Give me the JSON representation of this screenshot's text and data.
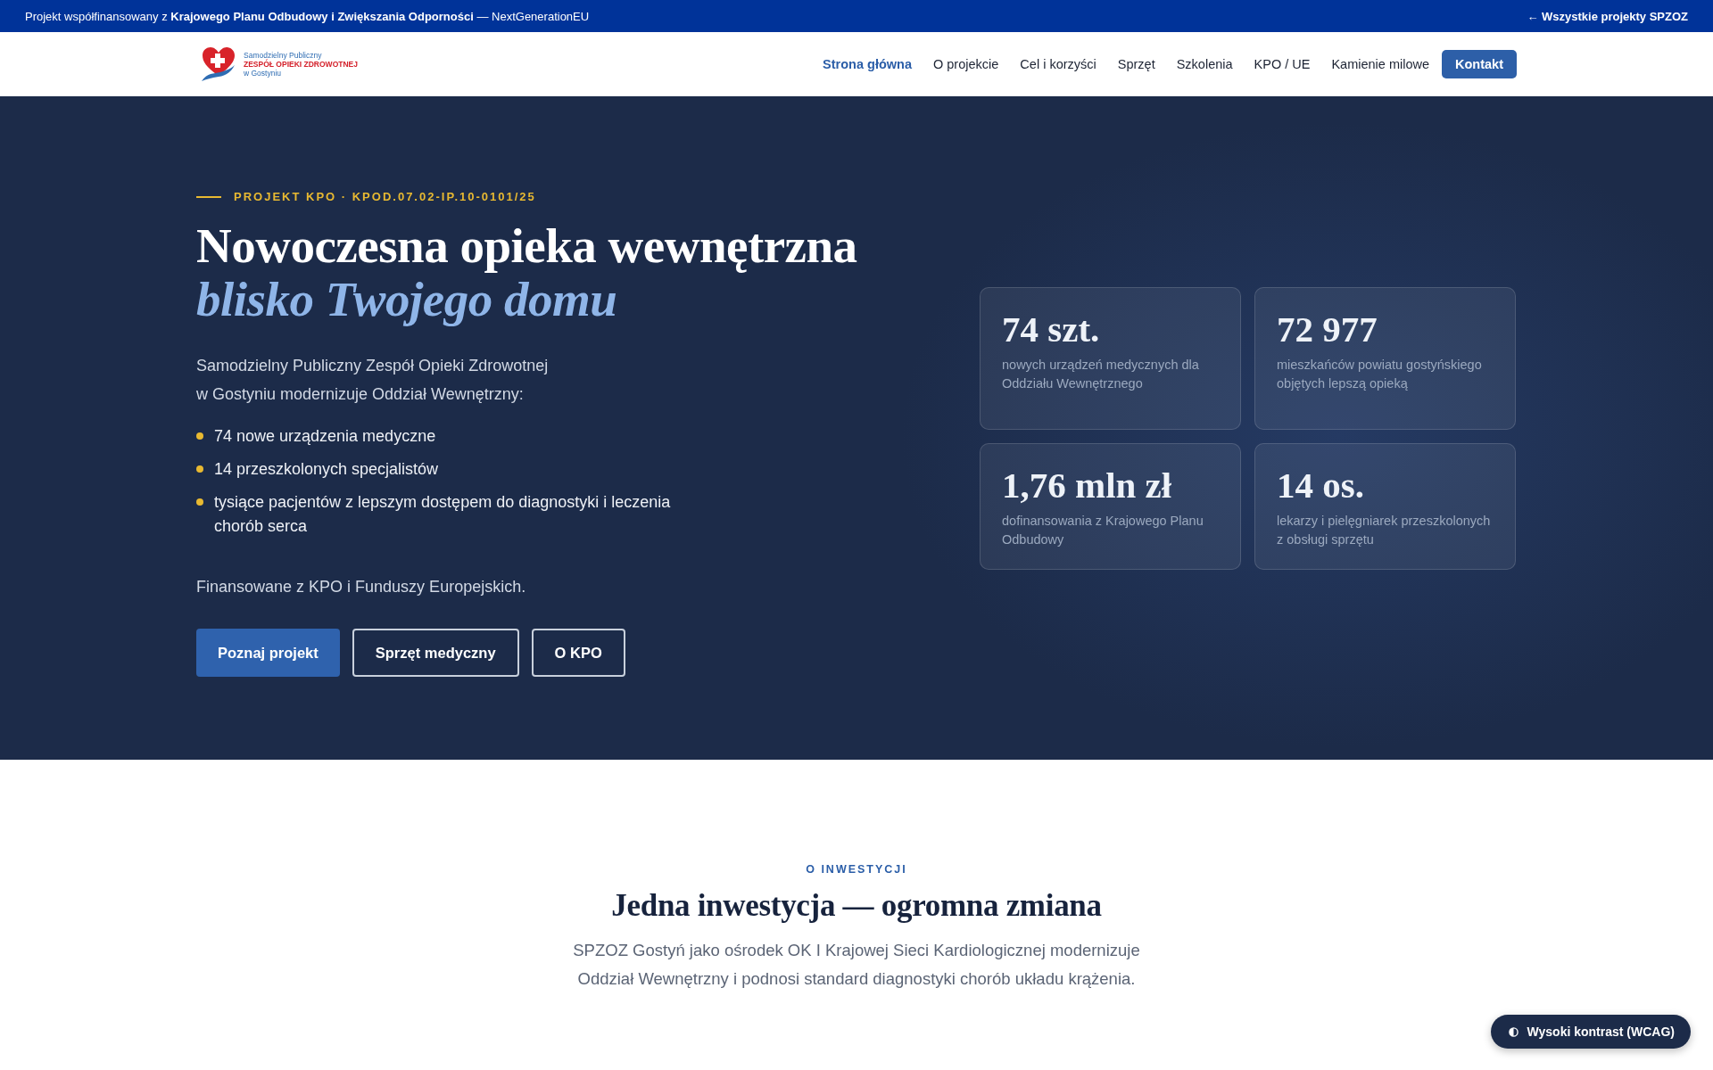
{
  "top_bar": {
    "text": "Projekt współfinansowany z **Krajowego Planu Odbudowy i Zwiększania Odporności** — NextGenerationEU",
    "back_link": "← Wszystkie projekty SPZOZ"
  },
  "header": {
    "logo": [
      "Samodzielny Publiczny",
      "ZESPÓŁ OPIEKI ZDROWOTNEJ",
      "w Gostyniu"
    ],
    "nav": [
      {
        "label": "Strona główna",
        "kind": "link",
        "selected": true
      },
      {
        "label": "O projekcie",
        "kind": "link",
        "selected": false
      },
      {
        "label": "Cel i korzyści",
        "kind": "link",
        "selected": false
      },
      {
        "label": "Sprzęt",
        "kind": "link",
        "selected": false
      },
      {
        "label": "Szkolenia",
        "kind": "link",
        "selected": false
      },
      {
        "label": "KPO / UE",
        "kind": "link",
        "selected": false
      },
      {
        "label": "Kamienie milowe",
        "kind": "link",
        "selected": false
      },
      {
        "label": "Kontakt",
        "kind": "button",
        "selected": false
      }
    ]
  },
  "hero": {
    "eyebrow": "PROJEKT KPO · KPOD.07.02-IP.10-0101/25",
    "title": "Nowoczesna opieka wewnętrzna",
    "title_accent": "blisko Twojego domu",
    "intro": [
      "Samodzielny Publiczny Zespół Opieki Zdrowotnej",
      "w Gostyniu modernizuje Oddział Wewnętrzny:"
    ],
    "bullets": [
      "74 nowe urządzenia medyczne",
      "14 przeszkolonych specjalistów",
      "tysiące pacjentów z lepszym dostępem do diagnostyki i leczenia chorób serca"
    ],
    "funding_note": "Finansowane z KPO i Funduszy Europejskich.",
    "buttons": [
      {
        "label": "Poznaj projekt",
        "kind": "primary"
      },
      {
        "label": "Sprzęt medyczny",
        "kind": "outline"
      },
      {
        "label": "O KPO",
        "kind": "outline"
      }
    ],
    "stats": [
      {
        "value": "74 szt.",
        "label": "nowych urządzeń medycznych dla Oddziału Wewnętrznego"
      },
      {
        "value": "72 977",
        "label": "mieszkańców powiatu gostyńskiego objętych lepszą opieką"
      },
      {
        "value": "1,76 mln zł",
        "label": "dofinansowania z Krajowego Planu Odbudowy"
      },
      {
        "value": "14 os.",
        "label": "lekarzy i pielęgniarek przeszkolonych z obsługi sprzętu"
      }
    ]
  },
  "about": {
    "eyebrow": "O INWESTYCJI",
    "title": "Jedna inwestycja — ogromna zmiana",
    "text": "SPZOZ Gostyń jako ośrodek OK I Krajowej Sieci Kardiologicznej modernizuje Oddział Wewnętrzny i podnosi standard diagnostyki chorób układu krążenia."
  },
  "contrast_toggle": {
    "label": "Wysoki kontrast (WCAG)"
  }
}
